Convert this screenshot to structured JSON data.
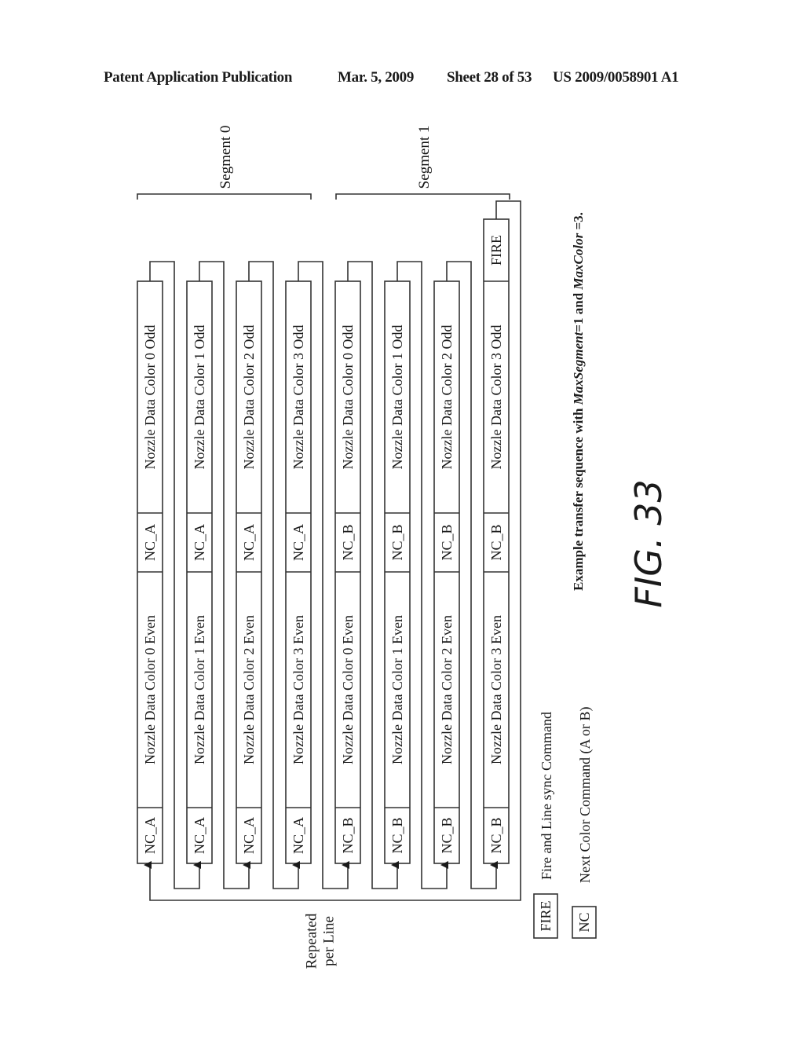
{
  "header": {
    "publication": "Patent Application Publication",
    "date": "Mar. 5, 2009",
    "sheet": "Sheet 28 of 53",
    "patent_number": "US 2009/0058901 A1"
  },
  "segments": [
    {
      "label": "Segment 0"
    },
    {
      "label": "Segment 1"
    }
  ],
  "columns": [
    {
      "nc_top": "NC_A",
      "odd": "Nozzle Data Color 0 Odd",
      "even": "Nozzle Data Color 0 Even",
      "nc_bottom": "NC_A"
    },
    {
      "nc_top": "NC_A",
      "odd": "Nozzle Data Color 1 Odd",
      "even": "Nozzle Data Color 1 Even",
      "nc_bottom": "NC_A"
    },
    {
      "nc_top": "NC_A",
      "odd": "Nozzle Data Color 2 Odd",
      "even": "Nozzle Data Color 2 Even",
      "nc_bottom": "NC_A"
    },
    {
      "nc_top": "NC_A",
      "odd": "Nozzle Data Color 3 Odd",
      "even": "Nozzle Data Color 3 Even",
      "nc_bottom": "NC_A"
    },
    {
      "nc_top": "NC_B",
      "odd": "Nozzle Data Color 0 Odd",
      "even": "Nozzle Data Color 0 Even",
      "nc_bottom": "NC_B"
    },
    {
      "nc_top": "NC_B",
      "odd": "Nozzle Data Color 1 Odd",
      "even": "Nozzle Data Color 1 Even",
      "nc_bottom": "NC_B"
    },
    {
      "nc_top": "NC_B",
      "odd": "Nozzle Data Color 2 Odd",
      "even": "Nozzle Data Color 2 Even",
      "nc_bottom": "NC_B"
    },
    {
      "nc_top": "NC_B",
      "odd": "Nozzle Data Color 3 Odd",
      "even": "Nozzle Data Color 3 Even",
      "nc_bottom": "NC_B",
      "fire": "FIRE"
    }
  ],
  "repeat_label": [
    "Repeated",
    "per Line"
  ],
  "legend": [
    {
      "key": "FIRE",
      "description": "Fire and Line sync Command"
    },
    {
      "key": "NC",
      "description": "Next Color Command (A or B)"
    }
  ],
  "caption": {
    "prefix": "Example transfer sequence with ",
    "var1": "MaxSegment",
    "mid": "=1 and ",
    "var2": "MaxColor",
    "suffix": " =3."
  },
  "figure_label": "FIG. 33"
}
